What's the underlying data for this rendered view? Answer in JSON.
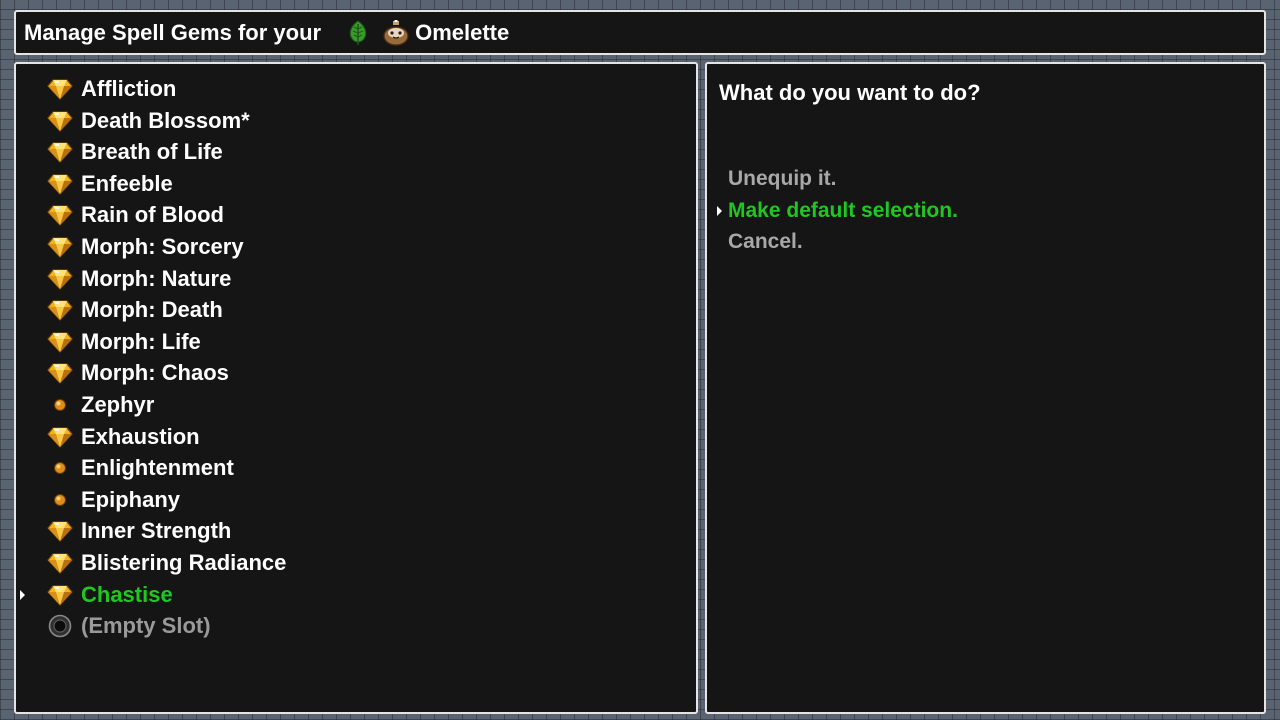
{
  "header": {
    "title_text": "Manage Spell Gems for your",
    "leaf_icon": "leaf-icon",
    "pet_icon": "pet-icon",
    "pet_name": "Omelette"
  },
  "gem_list": [
    {
      "label": "Affliction",
      "icon": "diamond-gem-icon",
      "state": "normal"
    },
    {
      "label": "Death Blossom*",
      "icon": "diamond-gem-icon",
      "state": "normal"
    },
    {
      "label": "Breath of Life",
      "icon": "diamond-gem-icon",
      "state": "normal"
    },
    {
      "label": "Enfeeble",
      "icon": "diamond-gem-icon",
      "state": "normal"
    },
    {
      "label": "Rain of Blood",
      "icon": "diamond-gem-icon",
      "state": "normal"
    },
    {
      "label": "Morph: Sorcery",
      "icon": "diamond-gem-icon",
      "state": "normal"
    },
    {
      "label": "Morph: Nature",
      "icon": "diamond-gem-icon",
      "state": "normal"
    },
    {
      "label": "Morph: Death",
      "icon": "diamond-gem-icon",
      "state": "normal"
    },
    {
      "label": "Morph: Life",
      "icon": "diamond-gem-icon",
      "state": "normal"
    },
    {
      "label": "Morph: Chaos",
      "icon": "diamond-gem-icon",
      "state": "normal"
    },
    {
      "label": "Zephyr",
      "icon": "orb-gem-icon",
      "state": "normal"
    },
    {
      "label": "Exhaustion",
      "icon": "diamond-gem-icon",
      "state": "normal"
    },
    {
      "label": "Enlightenment",
      "icon": "orb-gem-icon",
      "state": "normal"
    },
    {
      "label": "Epiphany",
      "icon": "orb-gem-icon",
      "state": "normal"
    },
    {
      "label": "Inner Strength",
      "icon": "diamond-gem-icon",
      "state": "normal"
    },
    {
      "label": "Blistering Radiance",
      "icon": "diamond-gem-icon",
      "state": "normal"
    },
    {
      "label": "Chastise",
      "icon": "diamond-gem-icon",
      "state": "selected"
    },
    {
      "label": "(Empty Slot)",
      "icon": "empty-slot-icon",
      "state": "empty"
    }
  ],
  "action_panel": {
    "prompt": "What do you want to do?",
    "options": [
      {
        "label": "Unequip it.",
        "state": "normal"
      },
      {
        "label": "Make default selection.",
        "state": "selected"
      },
      {
        "label": "Cancel.",
        "state": "normal"
      }
    ]
  },
  "colors": {
    "panel_bg": "#151515",
    "panel_border": "#e4e4e4",
    "text": "#ffffff",
    "selected_text": "#1ec81e",
    "inactive_text": "#a8a8a8",
    "gem_gold": "#f0b020"
  }
}
